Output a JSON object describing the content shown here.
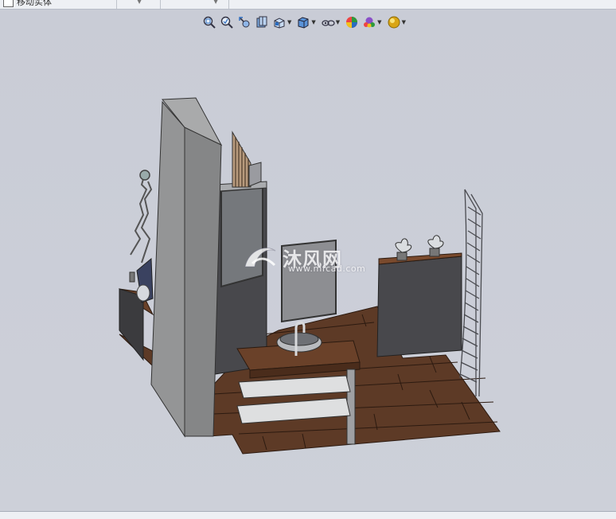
{
  "top_toolbar": {
    "command_label": "移动实体"
  },
  "heads_up_toolbar": {
    "buttons": [
      {
        "name": "zoom-to-fit-icon"
      },
      {
        "name": "zoom-to-area-icon"
      },
      {
        "name": "previous-view-icon"
      },
      {
        "name": "section-view-icon"
      },
      {
        "name": "view-orientation-icon",
        "has_dropdown": true
      },
      {
        "name": "display-style-icon",
        "has_dropdown": true
      },
      {
        "name": "hide-show-items-icon",
        "has_dropdown": true
      },
      {
        "name": "edit-appearance-icon"
      },
      {
        "name": "apply-scene-icon",
        "has_dropdown": true
      },
      {
        "name": "view-settings-icon",
        "has_dropdown": true
      }
    ]
  },
  "watermark": {
    "brand": "沐风网",
    "url": "www.mfcad.com"
  },
  "colors": {
    "viewport_background": "#cbced8",
    "floor_wood": "#5d3a26",
    "wall_grey": "#8f8f90",
    "dark_panel": "#48484c"
  }
}
